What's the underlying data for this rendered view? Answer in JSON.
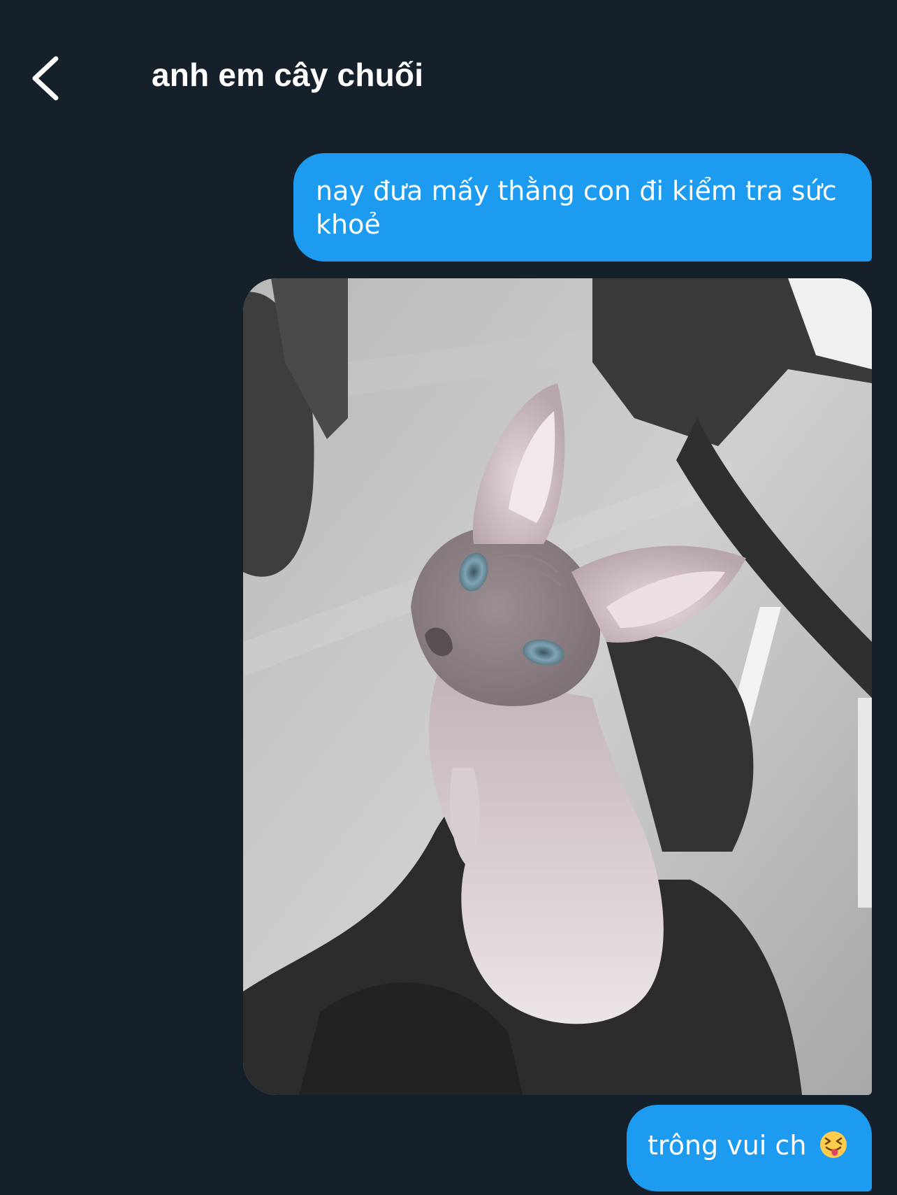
{
  "header": {
    "title": "anh em cây chuối",
    "back_icon": "chevron-left-icon"
  },
  "messages": [
    {
      "type": "text",
      "text": "nay đưa mấy thằng con đi kiểm tra sức khoẻ"
    },
    {
      "type": "image",
      "subject": "cat-photo"
    },
    {
      "type": "text",
      "text": "trông vui ch",
      "emoji": "squinting-face-with-tongue"
    }
  ],
  "colors": {
    "background": "#15202b",
    "bubble": "#1d9bf0",
    "text": "#ffffff"
  }
}
